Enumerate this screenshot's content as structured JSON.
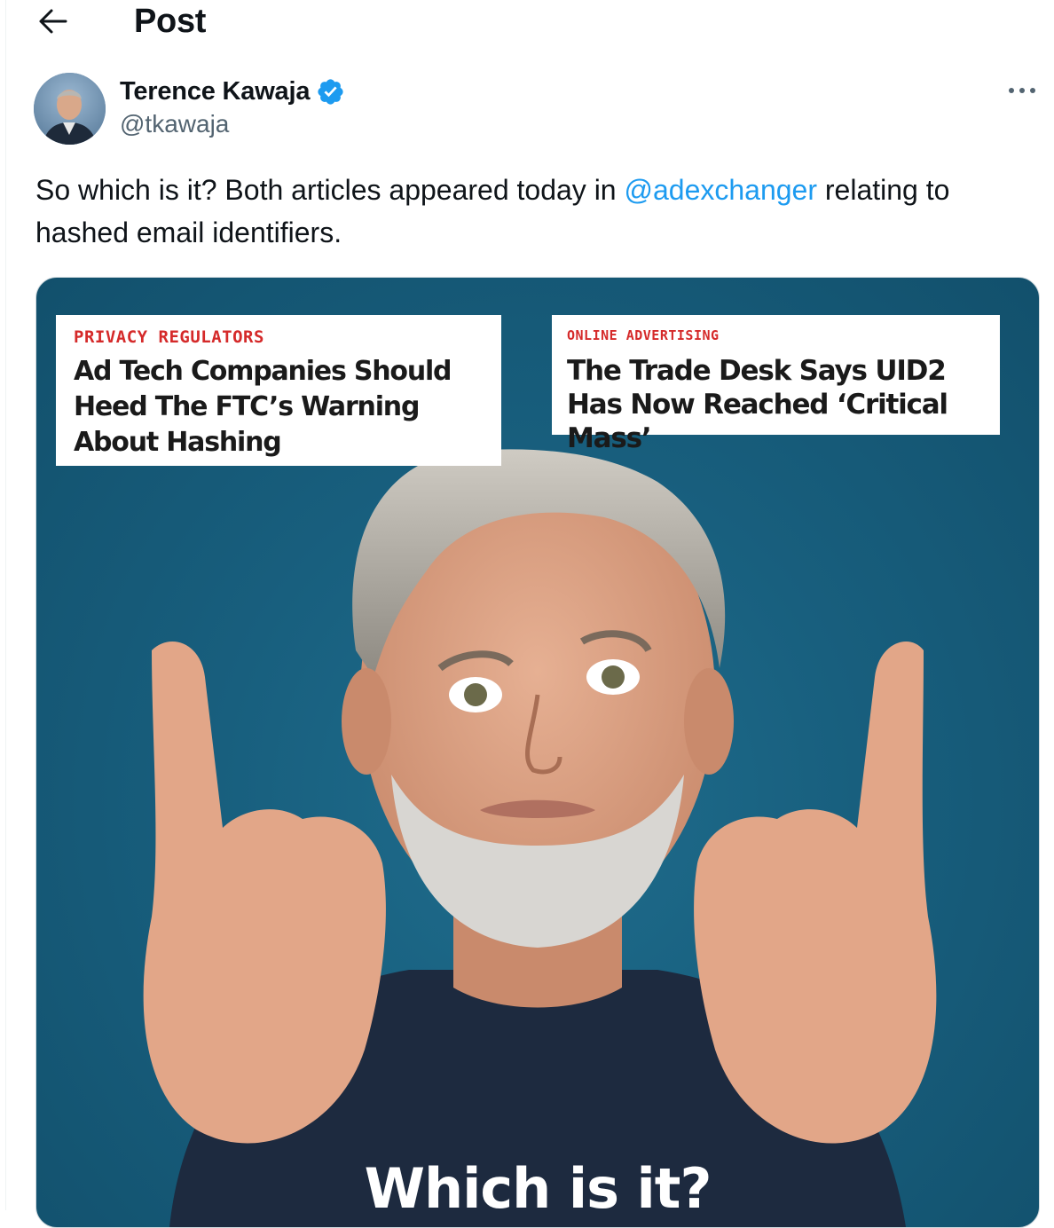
{
  "header": {
    "title": "Post",
    "back_icon": "arrow-left-icon"
  },
  "author": {
    "name": "Terence Kawaja",
    "handle": "@tkawaja",
    "verified": true,
    "verified_color": "#1d9bf0"
  },
  "more_icon": "more-horizontal-icon",
  "tweet": {
    "text_before": "So which is it? Both articles appeared today in ",
    "mention": "@adexchanger",
    "text_after": " relating to hashed email identifiers."
  },
  "media": {
    "card_left": {
      "label": "PRIVACY REGULATORS",
      "title": "Ad Tech Companies Should Heed The FTC’s Warning About Hashing"
    },
    "card_right": {
      "label": "ONLINE ADVERTISING",
      "title": "The Trade Desk Says UID2 Has Now Reached ‘Critical Mass’"
    },
    "caption": "Which is it?"
  },
  "colors": {
    "mention": "#1d9bf0",
    "secondary_text": "#536471",
    "label_red": "#d52a2a",
    "media_background": "#185f7e"
  }
}
